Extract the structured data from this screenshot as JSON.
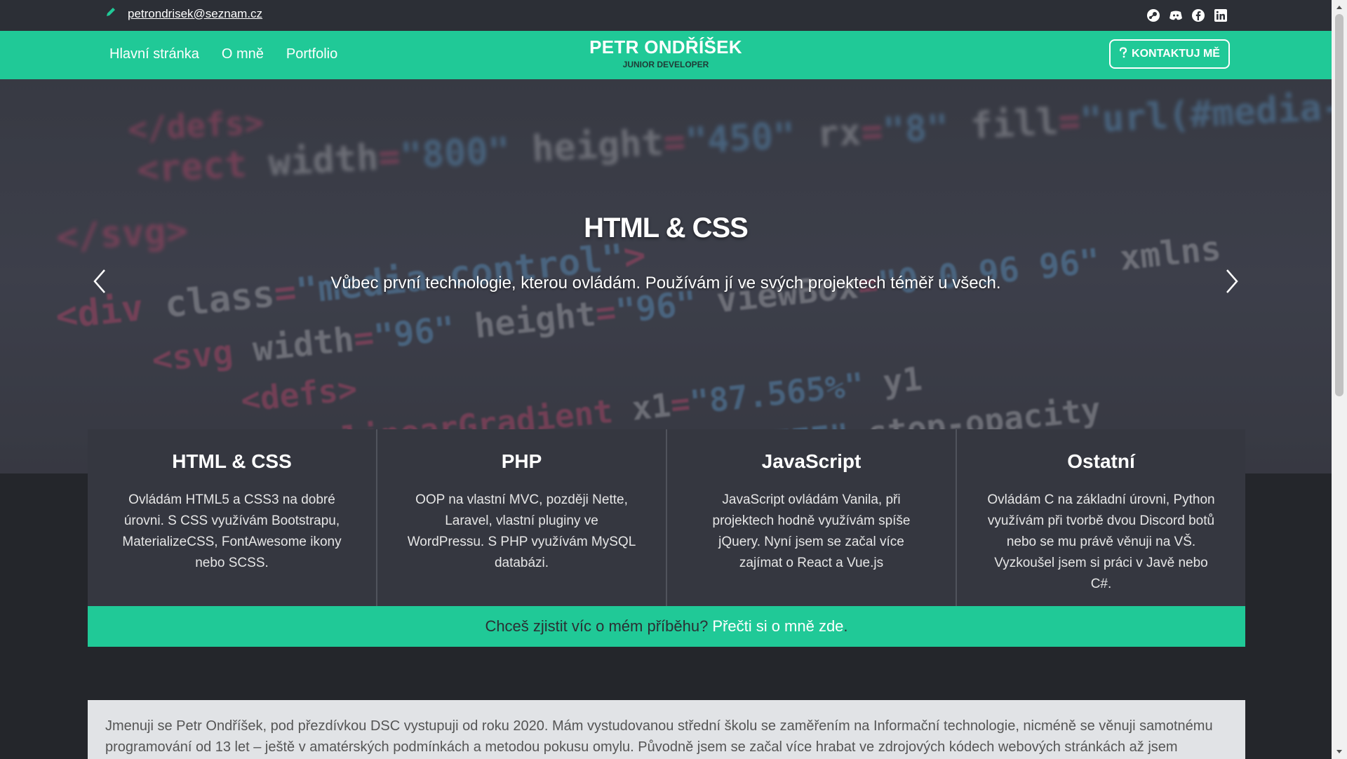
{
  "topbar": {
    "email": "petrondrisek@seznam.cz",
    "icons": [
      "pencil-icon",
      "steam-icon",
      "discord-icon",
      "facebook-icon",
      "linkedin-icon"
    ]
  },
  "nav": {
    "links": [
      "Hlavní stránka",
      "O mně",
      "Portfolio"
    ],
    "brand_name": "PETR ONDŘÍŠEK",
    "brand_sub": "JUNIOR DEVELOPER",
    "contact_label": "KONTAKTUJ MĚ"
  },
  "hero": {
    "title": "HTML & CSS",
    "text": "Vůbec první technologie, kterou ovládám. Používám jí ve svých projektech téměř u všech."
  },
  "cards": [
    {
      "title": "HTML & CSS",
      "text": "Ovládám HTML5 a CSS3 na dobré úrovni. S CSS využívám Bootstrapu, MaterializeCSS, FontAwesome ikony nebo SCSS."
    },
    {
      "title": "PHP",
      "text": "OOP na vlastní MVC, později Nette, Laravel, vlastní pluginy ve WordPressu. S PHP využívám MySQL databázi."
    },
    {
      "title": "JavaScript",
      "text": "JavaScript ovládám Vanila, při projektech hodně využívám spíše jQuery. Nyní jsem se začal více zajímat o React a Vue.js"
    },
    {
      "title": "Ostatní",
      "text": "Ovládám C na základní úrovni, Python využívám při tvorbě dvou Discord botů nebo se mu právě věnuji na VŠ. Vyzkoušel jsem si práci v Javě nebo C#."
    }
  ],
  "cta": {
    "text": "Chceš zjistit víc o mém příběhu?",
    "link": "Přečti si o mně zde",
    "end": "."
  },
  "about": {
    "text": "Jmenuji se Petr Ondříšek, pod přezdívkou DSC vystupuji od roku 2020. Mám vystudovanou střední školu se zaměřením na Informační technologie, nicméně se věnuji samotnému programování od 13 let – ještě v amatérských podmínkách a metodou pokusu omylu. Původně jsem se začal více hrabat ve zdrojových kódech webových stránkách až jsem pochopil"
  },
  "colors": {
    "accent": "#20c997",
    "topbar": "#2c2f36",
    "background": "#24262b",
    "card": "#353740"
  }
}
